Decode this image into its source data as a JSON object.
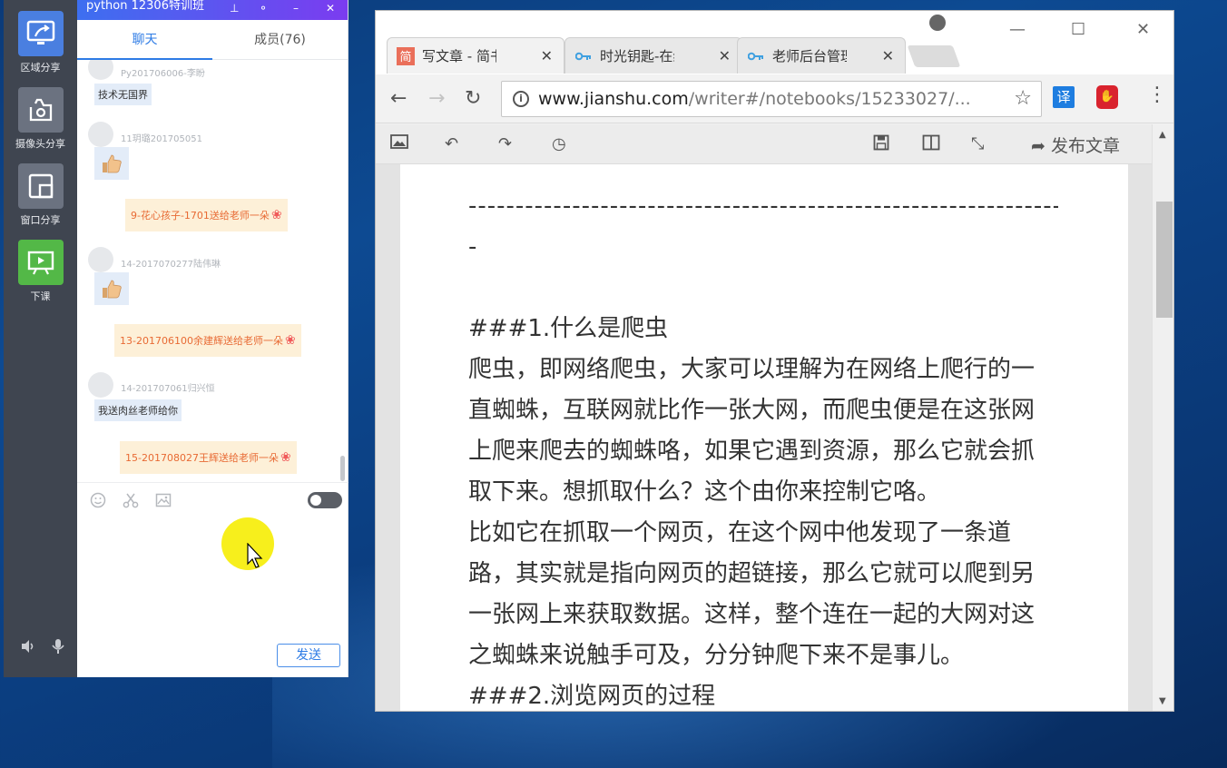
{
  "left_toolbar": {
    "tools": [
      {
        "label": "区域分享",
        "icon": "screen-share-icon",
        "color": "#4a7fe0"
      },
      {
        "label": "摄像头分享",
        "icon": "camera-share-icon",
        "color": "#6b7280"
      },
      {
        "label": "窗口分享",
        "icon": "window-share-icon",
        "color": "#6b7280"
      },
      {
        "label": "下课",
        "icon": "presentation-icon",
        "color": "#53b847"
      }
    ]
  },
  "chat": {
    "title": "python 12306特训班",
    "tabs": {
      "chat": "聊天",
      "members": "成员(76)"
    },
    "messages": [
      {
        "user": "Py201706006-李盼",
        "text": "技术无国界"
      },
      {
        "user": "11玥璐201705051",
        "text": ""
      },
      {
        "gift": "9-花心孩子-1701送给老师一朵"
      },
      {
        "user": "14-2017070277陆伟琳",
        "text": ""
      },
      {
        "gift": "13-201706100余建辉送给老师一朵"
      },
      {
        "user": "14-201707061归兴恒",
        "text": "我送肉丝老师给你"
      },
      {
        "gift": "15-201708027王辉送给老师一朵"
      }
    ],
    "send_label": "发送"
  },
  "browser": {
    "tabs": [
      {
        "title": "写文章 - 简书",
        "favicon": "简",
        "favicon_color": "#ea6f5a"
      },
      {
        "title": "时光钥匙-在线",
        "favicon": "key",
        "favicon_color": "#3fa0e0"
      },
      {
        "title": "老师后台管理",
        "favicon": "key",
        "favicon_color": "#3fa0e0"
      }
    ],
    "url_host": "www.jianshu.com",
    "url_path": "/writer#/notebooks/15233027/...",
    "translate_ext": "译",
    "publish_label": "发布文章",
    "content_lines": [
      "----------------------------------------------------------------------",
      "-",
      "",
      "###1.什么是爬虫",
      "爬虫，即网络爬虫，大家可以理解为在网络上爬行的一",
      "直蜘蛛，互联网就比作一张大网，而爬虫便是在这张网",
      "上爬来爬去的蜘蛛咯，如果它遇到资源，那么它就会抓",
      "取下来。想抓取什么？这个由你来控制它咯。",
      "比如它在抓取一个网页，在这个网中他发现了一条道",
      "路，其实就是指向网页的超链接，那么它就可以爬到另",
      "一张网上来获取数据。这样，整个连在一起的大网对这",
      "之蜘蛛来说触手可及，分分钟爬下来不是事儿。",
      "###2.浏览网页的过程"
    ]
  }
}
